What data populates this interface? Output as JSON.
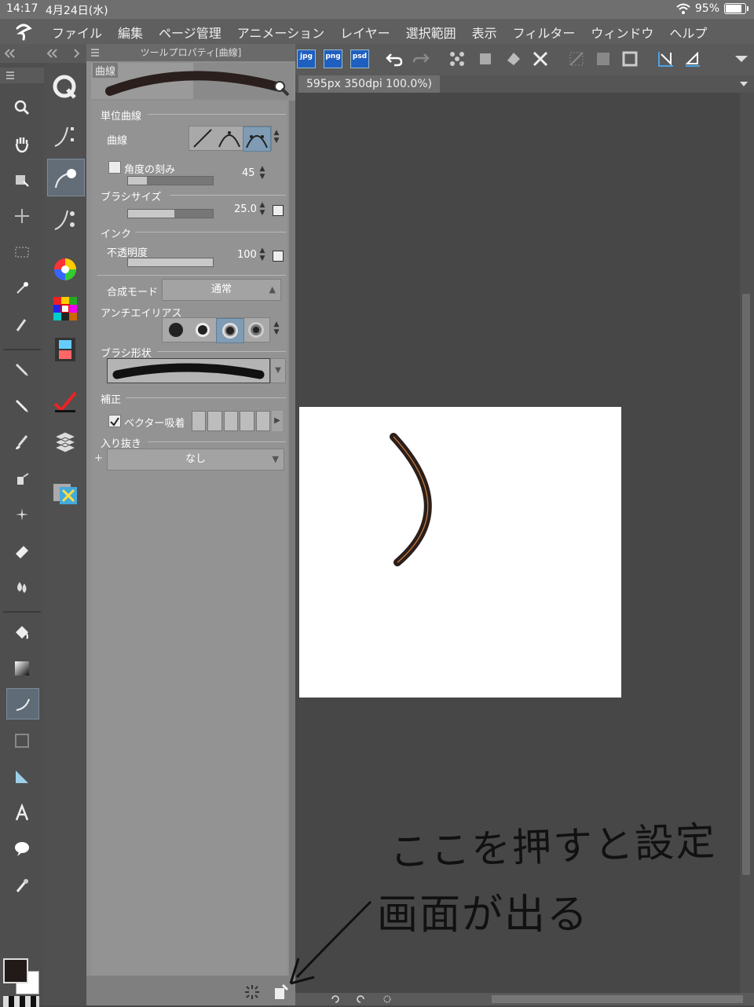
{
  "status": {
    "time": "14:17",
    "date": "4月24日(水)",
    "battery": "95%"
  },
  "menu": [
    "ファイル",
    "編集",
    "ページ管理",
    "アニメーション",
    "レイヤー",
    "選択範囲",
    "表示",
    "フィルター",
    "ウィンドウ",
    "ヘルプ"
  ],
  "toolbar": {
    "jpg": "jpg",
    "png": "png",
    "psd": "psd"
  },
  "doc_tab": "595px 350dpi 100.0%)",
  "panel": {
    "title": "ツールプロパティ[曲線]",
    "preview_label": "曲線",
    "sections": {
      "unit_curve": "単位曲線",
      "brush_size": "ブラシサイズ",
      "ink": "インク",
      "antialias": "アンチエイリアス",
      "brush_shape": "ブラシ形状",
      "correction": "補正",
      "entry_exit": "入り抜き"
    },
    "labels": {
      "curve": "曲線",
      "angle_step": "角度の刻み",
      "opacity": "不透明度",
      "blend_mode": "合成モード",
      "vector_snap": "ベクター吸着"
    },
    "values": {
      "angle_step": "45",
      "brush_size": "25.0",
      "opacity": "100",
      "blend_mode": "通常",
      "entry_exit": "なし"
    }
  },
  "annotation": {
    "line1": "ここを押すと設定",
    "line2": "画面が出る"
  }
}
